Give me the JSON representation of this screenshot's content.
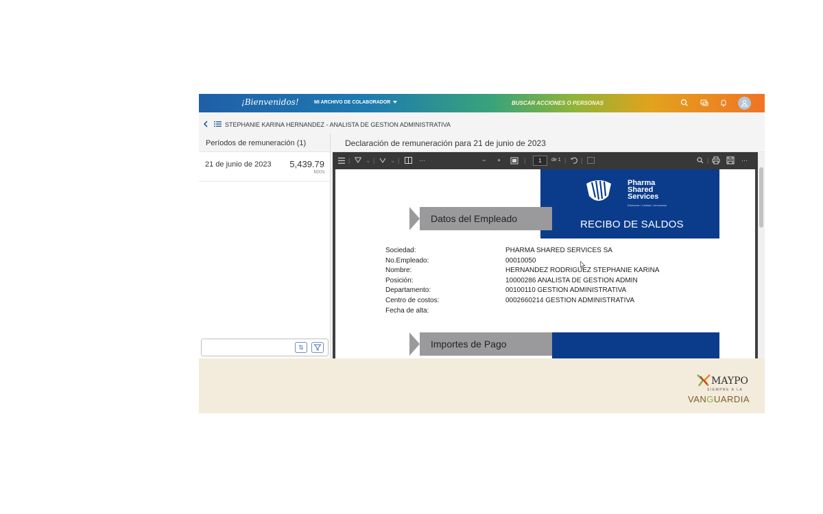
{
  "topbar": {
    "welcome": "¡Bienvenidos!",
    "menu_label": "MI ARCHIVO DE COLABORADOR",
    "search_label": "BUSCAR ACCIONES O PERSONAS"
  },
  "header": {
    "employee_title": "STEPHANIE KARINA HERNANDEZ - ANALISTA DE GESTION ADMINISTRATIVA"
  },
  "left_panel": {
    "title": "Períodos de remuneración (1)",
    "periods": [
      {
        "date": "21 de junio de 2023",
        "amount": "5,439.79",
        "currency": "MXN"
      }
    ]
  },
  "right_panel": {
    "title": "Declaración de remuneración para 21 de junio de 2023"
  },
  "viewer": {
    "page_number": "1",
    "page_of": "de 1"
  },
  "document": {
    "brand_lines": [
      "Pharma",
      "Shared",
      "Services"
    ],
    "tagline": "Eficiencia • Calidad • Innovación",
    "receipt_title": "RECIBO DE SALDOS",
    "section_employee": "Datos del Empleado",
    "section_payments": "Importes de Pago",
    "fields": [
      {
        "label": "Sociedad:",
        "value": "PHARMA SHARED SERVICES SA"
      },
      {
        "label": "No.Empleado:",
        "value": "00010050"
      },
      {
        "label": "Nombre:",
        "value": "HERNANDEZ RODRIGUEZ STEPHANIE KARINA"
      },
      {
        "label": "Posición:",
        "value": "10000286 ANALISTA DE GESTION ADMIN"
      },
      {
        "label": "Departamento:",
        "value": "00100110 GESTION ADMINISTRATIVA"
      },
      {
        "label": "Centro de costos:",
        "value": "0002660214 GESTION ADMINISTRATIVA"
      },
      {
        "label": "Fecha de alta:",
        "value": ""
      }
    ]
  },
  "footer": {
    "logo_name": "MAYPO",
    "logo_sub": "SIEMPRE A LA",
    "logo_tag_a": "VAN",
    "logo_tag_b": "G",
    "logo_tag_c": "UARDIA"
  },
  "colors": {
    "doc_blue": "#0b3c8c",
    "banner_gray": "#9a9a9c",
    "footer_bg": "#f3ebdc"
  }
}
